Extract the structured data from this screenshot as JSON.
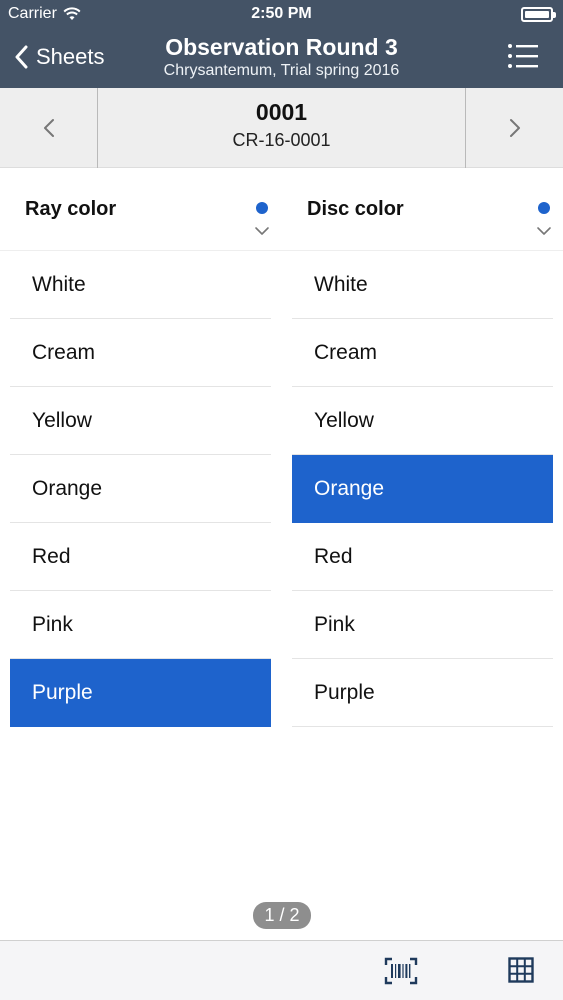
{
  "status_bar": {
    "carrier": "Carrier",
    "time": "2:50 PM",
    "wifi_icon": "wifi-icon",
    "battery_icon": "battery-icon"
  },
  "header": {
    "back_label": "Sheets",
    "title": "Observation Round 3",
    "subtitle": "Chrysantemum, Trial spring 2016",
    "menu_icon": "list-icon",
    "background_color": "#445366"
  },
  "record_nav": {
    "prev_icon": "chevron-left-icon",
    "next_icon": "chevron-right-icon",
    "record_id": "0001",
    "record_code": "CR-16-0001"
  },
  "columns": [
    {
      "title": "Ray color",
      "indicator_color": "#1e63cc",
      "selected": "Purple",
      "options": [
        "White",
        "Cream",
        "Yellow",
        "Orange",
        "Red",
        "Pink",
        "Purple"
      ]
    },
    {
      "title": "Disc color",
      "indicator_color": "#1e63cc",
      "selected": "Orange",
      "options": [
        "White",
        "Cream",
        "Yellow",
        "Orange",
        "Red",
        "Pink",
        "Purple"
      ]
    }
  ],
  "pagination": {
    "label": "1 / 2"
  },
  "toolbar": {
    "barcode_icon": "barcode-scan-icon",
    "grid_icon": "grid-icon"
  },
  "accent_color": "#1e63cc"
}
